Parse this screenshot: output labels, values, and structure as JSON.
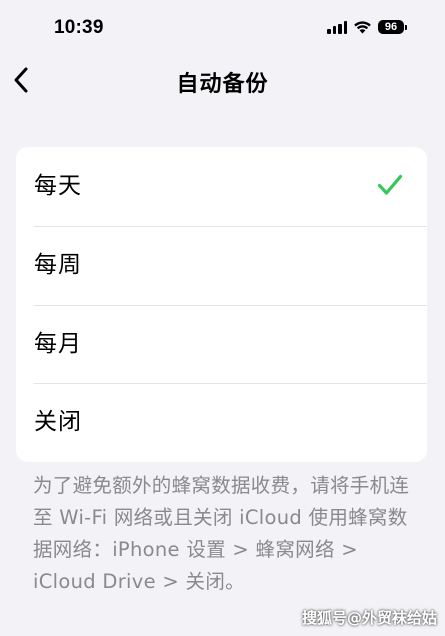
{
  "status_bar": {
    "time": "10:39",
    "battery": "96",
    "signal_icon": "cellular-signal-icon",
    "wifi_icon": "wifi-icon"
  },
  "nav": {
    "back_icon": "chevron-left-icon",
    "title": "自动备份"
  },
  "options": [
    {
      "label": "每天",
      "selected": true
    },
    {
      "label": "每周",
      "selected": false
    },
    {
      "label": "每月",
      "selected": false
    },
    {
      "label": "关闭",
      "selected": false
    }
  ],
  "colors": {
    "accent": "#34c759",
    "background": "#f2f2f7",
    "secondary_text": "#8a8a8e"
  },
  "footer_note": "为了避免额外的蜂窝数据收费，请将手机连至 Wi-Fi 网络或且关闭 iCloud 使用蜂窝数据网络：iPhone 设置 > 蜂窝网络 > iCloud Drive > 关闭。",
  "watermark": "搜狐号@外贸袜给姑"
}
